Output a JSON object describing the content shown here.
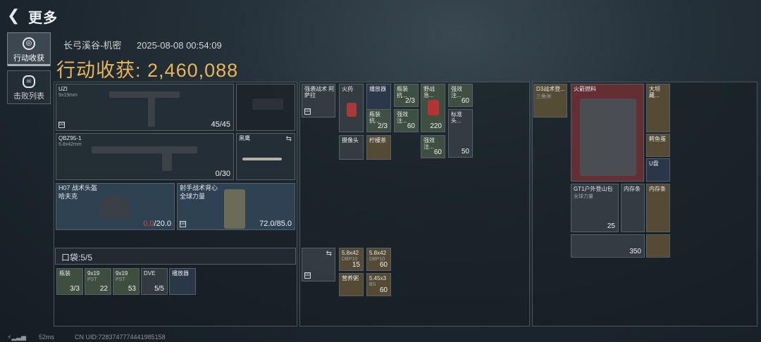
{
  "header": {
    "title": "更多",
    "back_icon": "back-arrow-icon"
  },
  "tabs": [
    {
      "label": "行动收获",
      "icon": "target-icon",
      "active": true
    },
    {
      "label": "击败列表",
      "icon": "skull-icon",
      "active": false
    }
  ],
  "raid": {
    "map": "长弓溪谷-机密",
    "time": "2025-08-08 00:54:09",
    "income_label": "行动收获:",
    "income_value": "2,460,088"
  },
  "gear": {
    "primary": {
      "name": "UZI",
      "caliber": "9x19mm",
      "ammo": "45/45"
    },
    "secondary": {
      "name": "QBZ95-1",
      "caliber": "5.8x42mm",
      "ammo": "0/30"
    },
    "melee": {
      "name": "黑鹰"
    },
    "helmet": {
      "name": "H07 战术头盔",
      "sub": "哈夫克",
      "dur": "0.0",
      "dur_max": "/20.0"
    },
    "vest": {
      "name": "射手战术背心",
      "sub": "全球力量",
      "dur": "72.0/85.0"
    }
  },
  "pocket": {
    "label": "口袋:5/5",
    "items": [
      {
        "name": "瓶装",
        "count": "3/3"
      },
      {
        "name": "9x19",
        "sub": "PST",
        "count": "22"
      },
      {
        "name": "9x19",
        "sub": "PST",
        "count": "53"
      },
      {
        "name": "DVE",
        "count": "5/5"
      },
      {
        "name": "播放器",
        "count": ""
      }
    ]
  },
  "rig": [
    {
      "name": "强袭战术 阿萨拉",
      "count": ""
    },
    {
      "name": "火药",
      "count": ""
    },
    {
      "name": "播放器",
      "count": ""
    },
    {
      "name": "瓶装抗...",
      "count": "2/3"
    },
    {
      "name": "野战急...",
      "count": "220"
    },
    {
      "name": "强效注...",
      "count": "60"
    },
    {
      "name": "瓶装抗...",
      "count": "2/3"
    },
    {
      "name": "强效注...",
      "count": "60"
    },
    {
      "name": "标准头...",
      "count": "50"
    },
    {
      "name": "摄像头",
      "count": ""
    },
    {
      "name": "柠檬茶",
      "count": ""
    },
    {
      "name": "强效注...",
      "count": "60"
    }
  ],
  "ammo_box": [
    {
      "name": "5.8x42",
      "sub": "DBP10",
      "count": "15"
    },
    {
      "name": "5.8x42",
      "sub": "DBP10",
      "count": "60"
    },
    {
      "name": "营养粥",
      "count": ""
    },
    {
      "name": "5.45x3",
      "sub": "BS",
      "count": "60"
    }
  ],
  "backpack": [
    {
      "name": "D3战术登...",
      "sub": "三角洲"
    },
    {
      "name": "火箭燃料"
    },
    {
      "name": "大坝藏..."
    },
    {
      "name": "鳄鱼蛋"
    },
    {
      "name": "U盘"
    },
    {
      "name": "GT1户外登山包",
      "sub": "全球力量",
      "count": "25"
    },
    {
      "name": "内存条"
    },
    {
      "name": "内存条"
    },
    {
      "name": "",
      "count": "350"
    }
  ],
  "footer": {
    "ping": "52ms",
    "uid": "CN UID:7283747774441985158"
  }
}
